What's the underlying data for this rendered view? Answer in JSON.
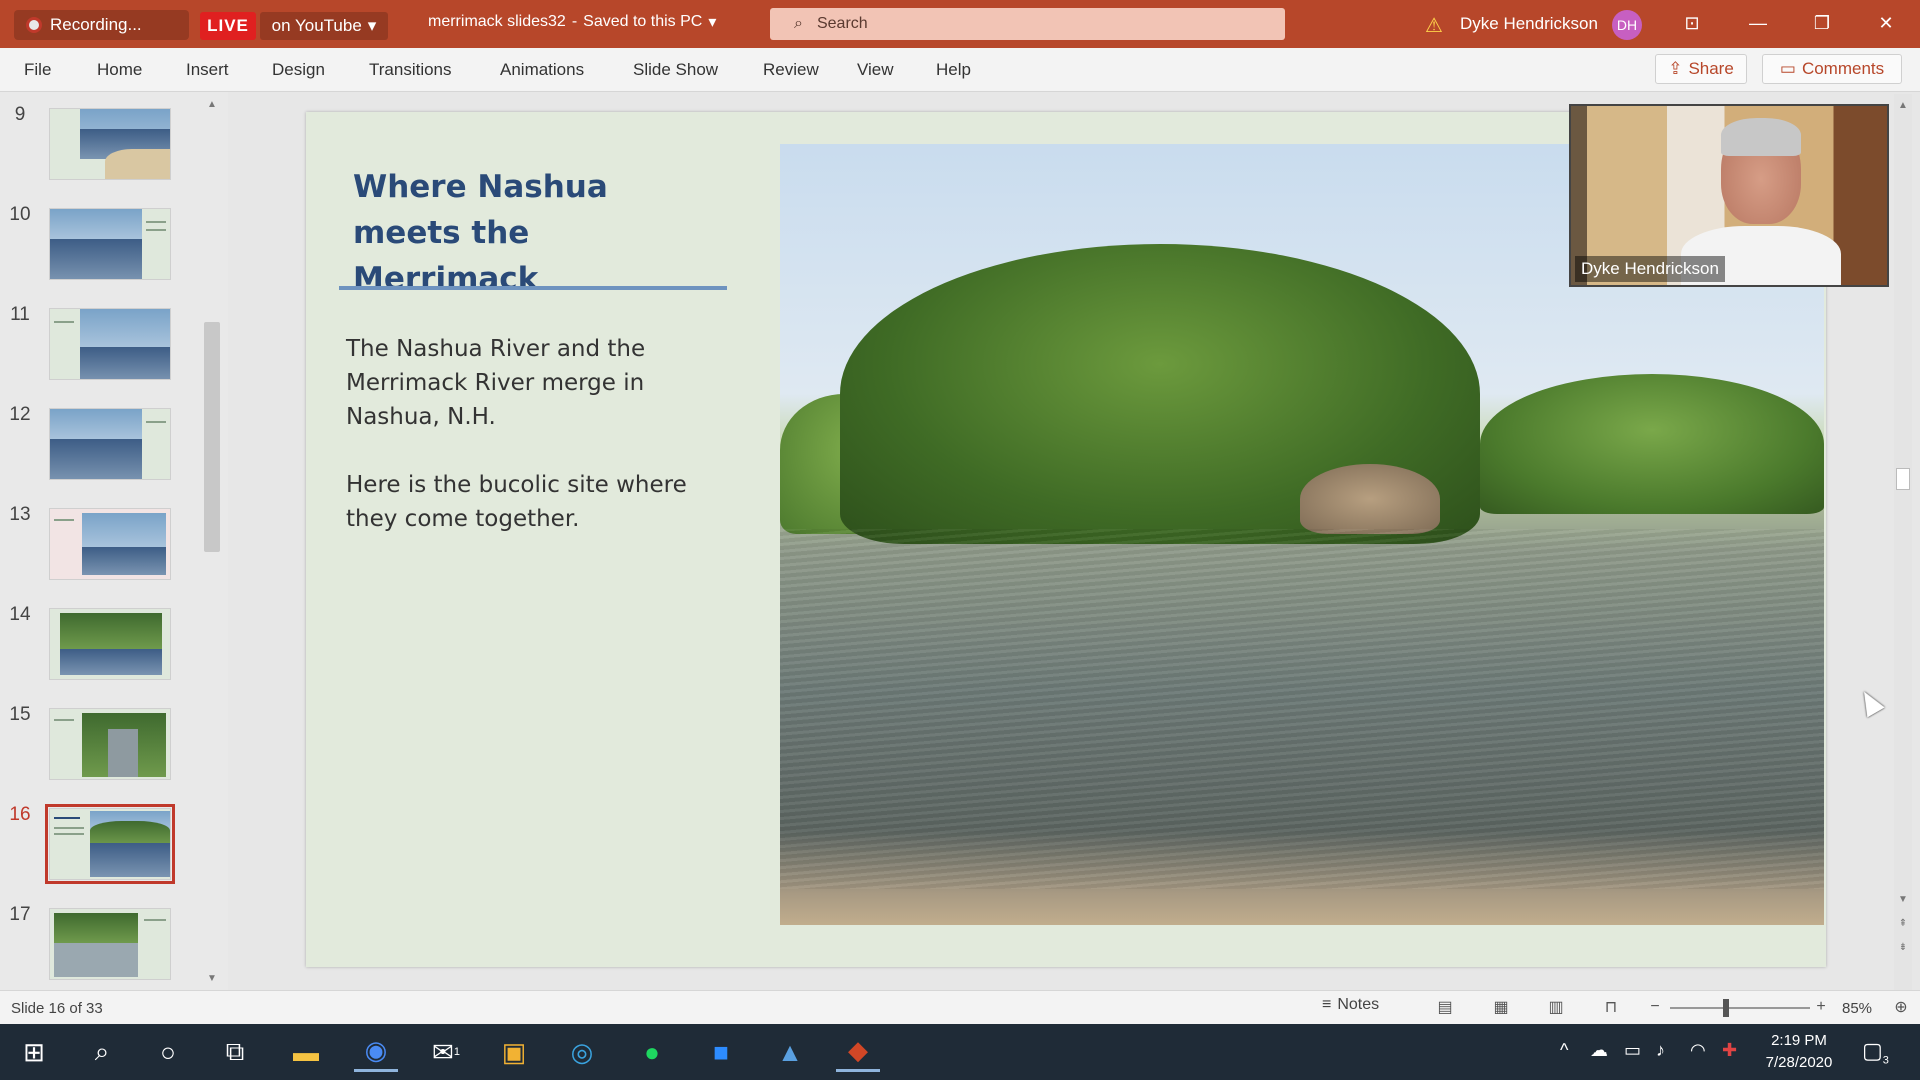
{
  "titlebar": {
    "recording_label": "Recording...",
    "live_label": "LIVE",
    "youtube_label": "on YouTube",
    "doc_name": "merrimack slides32",
    "save_status": "Saved to this PC",
    "search_placeholder": "Search",
    "user_name": "Dyke Hendrickson",
    "user_initials": "DH"
  },
  "ribbon": {
    "tabs": [
      "File",
      "Home",
      "Insert",
      "Design",
      "Transitions",
      "Animations",
      "Slide Show",
      "Review",
      "View",
      "Help"
    ],
    "share_label": "Share",
    "comments_label": "Comments"
  },
  "thumbnails": [
    {
      "num": "9"
    },
    {
      "num": "10"
    },
    {
      "num": "11"
    },
    {
      "num": "12"
    },
    {
      "num": "13"
    },
    {
      "num": "14"
    },
    {
      "num": "15"
    },
    {
      "num": "16"
    },
    {
      "num": "17"
    }
  ],
  "slide": {
    "title": "Where Nashua meets the Merrimack",
    "body_paragraph_1": "The Nashua River and the Merrimack River merge in Nashua, N.H.",
    "body_paragraph_2": "Here  is the bucolic site where they come together."
  },
  "video": {
    "participant_name": "Dyke Hendrickson"
  },
  "statusbar": {
    "slide_counter": "Slide 16 of 33",
    "notes_label": "Notes",
    "zoom_minus": "−",
    "zoom_plus": "+",
    "zoom_level": "85%"
  },
  "taskbar": {
    "mail_badge": "1",
    "time": "2:19 PM",
    "date": "7/28/2020",
    "notification_count": "3"
  },
  "colors": {
    "titlebar": "#b7472a",
    "slide_title": "#2a4a78",
    "slide_background": "#e2eadc",
    "active_thumb_border": "#c0392b"
  }
}
